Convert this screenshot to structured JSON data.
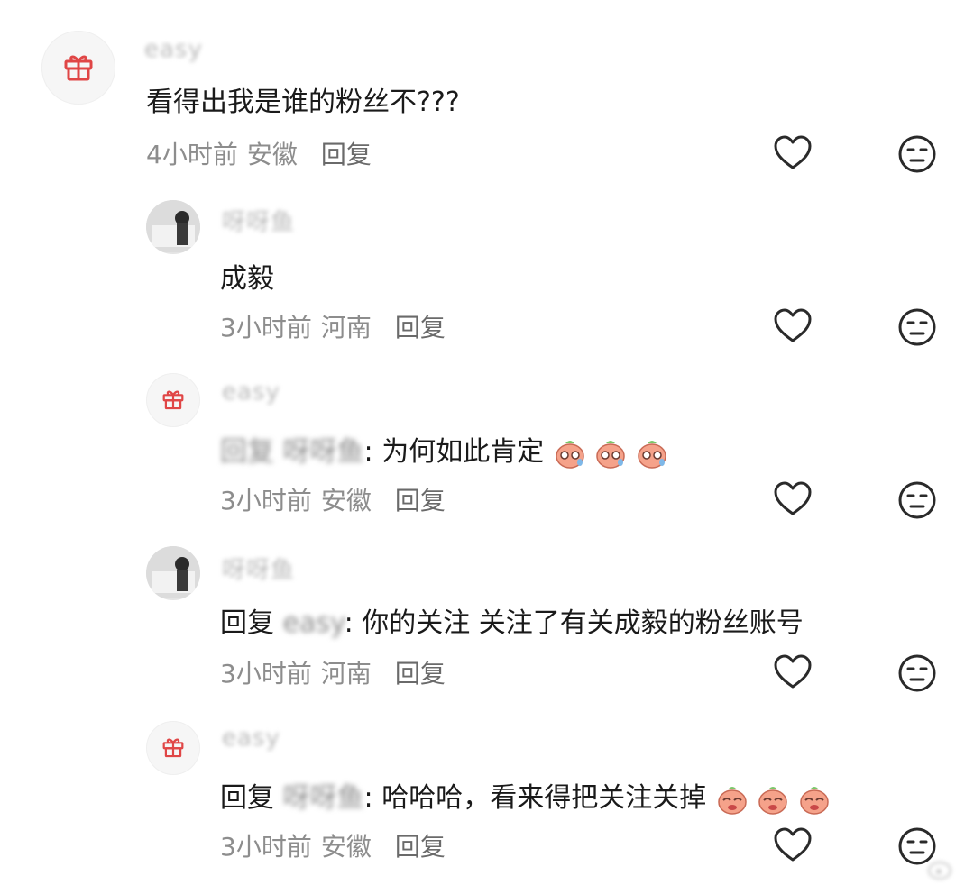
{
  "comments": [
    {
      "username": "easy",
      "avatar": "gift-icon",
      "reply_prefix": "",
      "reply_target": "",
      "text": "看得出我是谁的粉丝不???",
      "time": "4小时前",
      "location": "安徽",
      "reply_label": "回复"
    },
    {
      "username": "呀呀鱼",
      "avatar": "user-photo",
      "reply_prefix": "",
      "reply_target": "",
      "text": "成毅",
      "time": "3小时前",
      "location": "河南",
      "reply_label": "回复"
    },
    {
      "username": "easy",
      "avatar": "gift-icon",
      "reply_prefix": "回复",
      "reply_target": "呀呀鱼",
      "text": ": 为何如此肯定",
      "emoji": "sweating-face-emoji",
      "emoji_count": 3,
      "time": "3小时前",
      "location": "安徽",
      "reply_label": "回复"
    },
    {
      "username": "呀呀鱼",
      "avatar": "user-photo",
      "reply_prefix": "回复",
      "reply_target": "easy",
      "text": ": 你的关注 关注了有关成毅的粉丝账号",
      "time": "3小时前",
      "location": "河南",
      "reply_label": "回复"
    },
    {
      "username": "easy",
      "avatar": "gift-icon",
      "reply_prefix": "回复",
      "reply_target": "呀呀鱼",
      "text": ": 哈哈哈，看来得把关注关掉",
      "emoji": "laughing-face-emoji",
      "emoji_count": 3,
      "time": "3小时前",
      "location": "安徽",
      "reply_label": "回复"
    }
  ],
  "colors": {
    "meta": "#8d8d8d",
    "text": "#1a1a1a",
    "icon": "#2a2a2a",
    "gift": "#e04646",
    "emoji_face": "#f5a28a"
  }
}
